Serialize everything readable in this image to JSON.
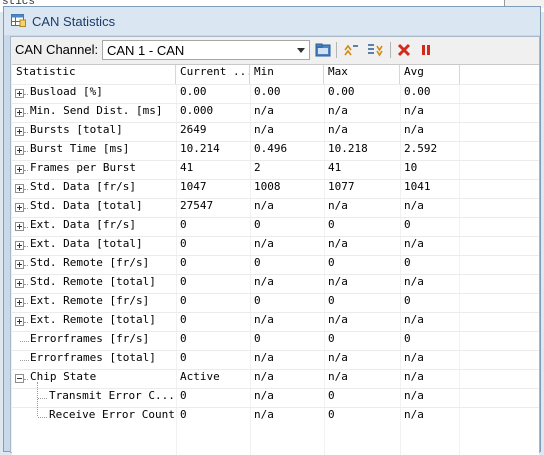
{
  "background": {
    "fragment": "stics"
  },
  "window": {
    "title": "CAN Statistics",
    "icon": "table-chart-icon"
  },
  "toolbar": {
    "channel_label": "CAN Channel:",
    "channel_value": "CAN 1 - CAN",
    "buttons": [
      "open-folder-icon",
      "sort-ascending-icon",
      "sort-descending-icon",
      "reset-icon",
      "pause-icon"
    ]
  },
  "table": {
    "columns": [
      "Statistic",
      "Current ...",
      "Min",
      "Max",
      "Avg"
    ],
    "rows": [
      {
        "name": "Busload [%]",
        "expander": "plus",
        "current": "0.00",
        "min": "0.00",
        "max": "0.00",
        "avg": "0.00"
      },
      {
        "name": "Min. Send Dist. [ms]",
        "expander": "plus",
        "current": "0.000",
        "min": "n/a",
        "max": "n/a",
        "avg": "n/a"
      },
      {
        "name": "Bursts [total]",
        "expander": "plus",
        "current": "2649",
        "min": "n/a",
        "max": "n/a",
        "avg": "n/a"
      },
      {
        "name": "Burst Time [ms]",
        "expander": "plus",
        "current": "10.214",
        "min": "0.496",
        "max": "10.218",
        "avg": "2.592"
      },
      {
        "name": "Frames per Burst",
        "expander": "plus",
        "current": "41",
        "min": "2",
        "max": "41",
        "avg": "10"
      },
      {
        "name": "Std. Data [fr/s]",
        "expander": "plus",
        "current": "1047",
        "min": "1008",
        "max": "1077",
        "avg": "1041"
      },
      {
        "name": "Std. Data [total]",
        "expander": "plus",
        "current": "27547",
        "min": "n/a",
        "max": "n/a",
        "avg": "n/a"
      },
      {
        "name": "Ext. Data [fr/s]",
        "expander": "plus",
        "current": "0",
        "min": "0",
        "max": "0",
        "avg": "0"
      },
      {
        "name": "Ext. Data [total]",
        "expander": "plus",
        "current": "0",
        "min": "n/a",
        "max": "n/a",
        "avg": "n/a"
      },
      {
        "name": "Std. Remote [fr/s]",
        "expander": "plus",
        "current": "0",
        "min": "0",
        "max": "0",
        "avg": "0"
      },
      {
        "name": "Std. Remote [total]",
        "expander": "plus",
        "current": "0",
        "min": "n/a",
        "max": "n/a",
        "avg": "n/a"
      },
      {
        "name": "Ext. Remote [fr/s]",
        "expander": "plus",
        "current": "0",
        "min": "0",
        "max": "0",
        "avg": "0"
      },
      {
        "name": "Ext. Remote [total]",
        "expander": "plus",
        "current": "0",
        "min": "n/a",
        "max": "n/a",
        "avg": "n/a"
      },
      {
        "name": "Errorframes [fr/s]",
        "expander": "none",
        "current": "0",
        "min": "0",
        "max": "0",
        "avg": "0"
      },
      {
        "name": "Errorframes [total]",
        "expander": "none",
        "current": "0",
        "min": "n/a",
        "max": "n/a",
        "avg": "n/a"
      },
      {
        "name": "Chip State",
        "expander": "minus",
        "current": "Active",
        "min": "n/a",
        "max": "n/a",
        "avg": "n/a"
      },
      {
        "name": "Transmit Error C...",
        "expander": "child",
        "current": "0",
        "min": "n/a",
        "max": "0",
        "avg": "n/a"
      },
      {
        "name": "Receive Error Count",
        "expander": "child",
        "current": "0",
        "min": "n/a",
        "max": "0",
        "avg": "n/a"
      }
    ]
  }
}
